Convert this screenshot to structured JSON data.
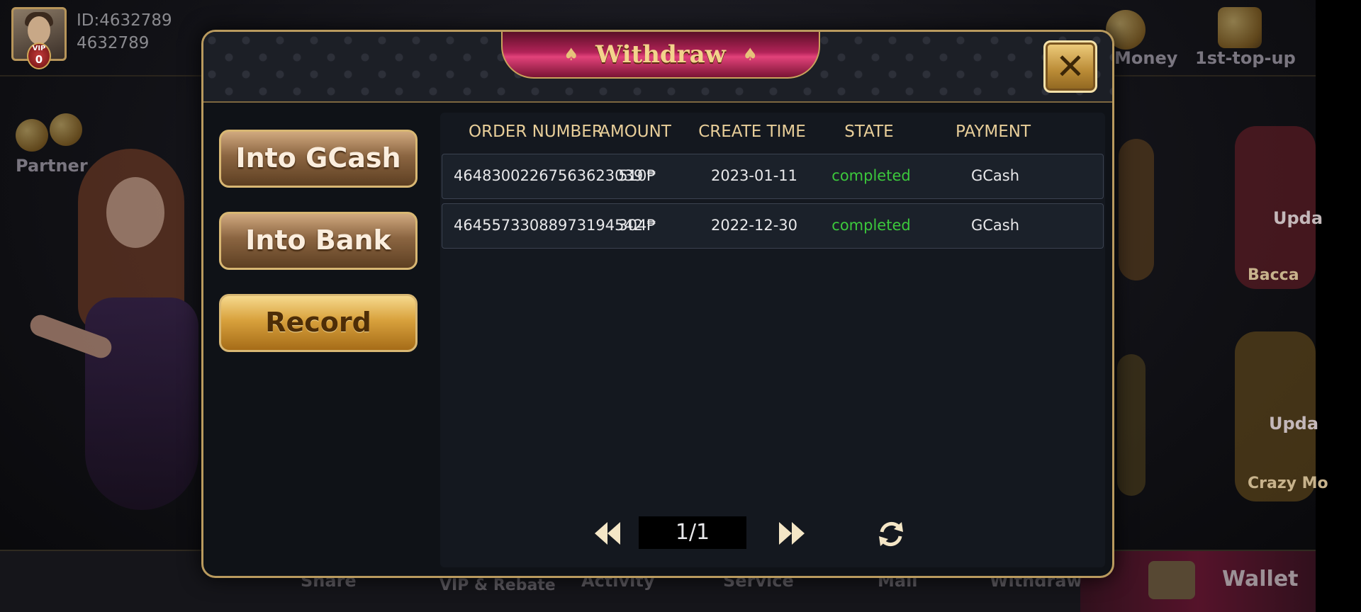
{
  "background": {
    "user": {
      "id_label": "ID:4632789",
      "name": "4632789",
      "vip_text": "VIP",
      "vip_level": "0"
    },
    "labels": {
      "partner": "Partner",
      "money": "Money",
      "first_topup": "1st-top-up",
      "update_1": "Upda",
      "baccarat": "Bacca",
      "update_2": "Upda",
      "crazy": "Crazy Mo"
    },
    "bottom_nav": [
      {
        "label": "Share"
      },
      {
        "label": "VIP & Rebate"
      },
      {
        "label": "Activity"
      },
      {
        "label": "Service"
      },
      {
        "label": "Mail"
      },
      {
        "label": "Withdraw"
      }
    ],
    "wallet_label": "Wallet"
  },
  "modal": {
    "title": "Withdraw",
    "close_glyph": "✕",
    "tabs": [
      {
        "label": "Into GCash",
        "active": false
      },
      {
        "label": "Into Bank",
        "active": false
      },
      {
        "label": "Record",
        "active": true
      }
    ],
    "table": {
      "columns": [
        "ORDER NUMBER",
        "AMOUNT",
        "CREATE TIME",
        "STATE",
        "PAYMENT"
      ],
      "rows": [
        {
          "order_number": "46483002267563623039",
          "amount": "510₱",
          "create_time": "2023-01-11",
          "state": "completed",
          "payment": "GCash"
        },
        {
          "order_number": "46455733088973194542",
          "amount": "304₱",
          "create_time": "2022-12-30",
          "state": "completed",
          "payment": "GCash"
        }
      ]
    },
    "pagination": {
      "page_text": "1/1"
    }
  },
  "colors": {
    "accent_gold": "#d8b773",
    "state_completed": "#3cc83c",
    "header_text": "#e8ce99",
    "title_pink": "#e2427a"
  },
  "icons": {
    "prev": "double-left-arrow-icon",
    "next": "double-right-arrow-icon",
    "refresh": "refresh-icon",
    "close": "close-icon"
  }
}
